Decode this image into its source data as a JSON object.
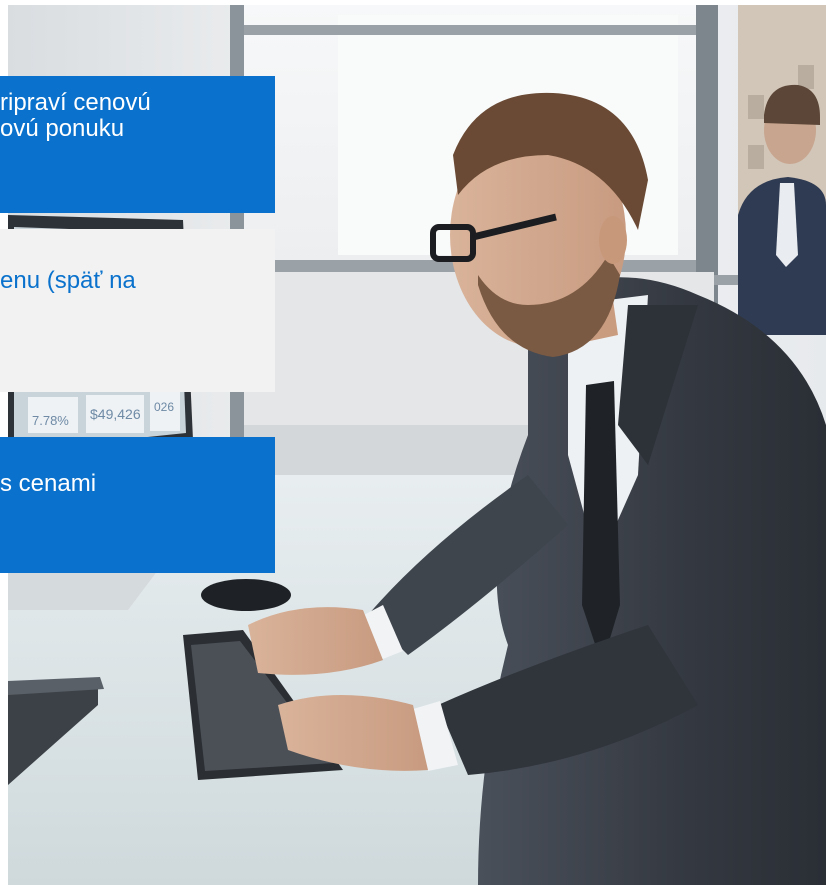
{
  "callouts": [
    {
      "lines": [
        "ripraví cenovú",
        "ovú ponuku"
      ]
    },
    {
      "lines": [
        "enu (späť na"
      ]
    },
    {
      "lines": [
        "s cenami"
      ]
    }
  ],
  "monitor": {
    "readouts": [
      "7.78%",
      "$49,426",
      "026"
    ]
  },
  "colors": {
    "accent_blue": "#0a72cc",
    "light_panel": "#f2f2f2",
    "suit": "#3b4048",
    "desk": "#dfe8ea"
  }
}
